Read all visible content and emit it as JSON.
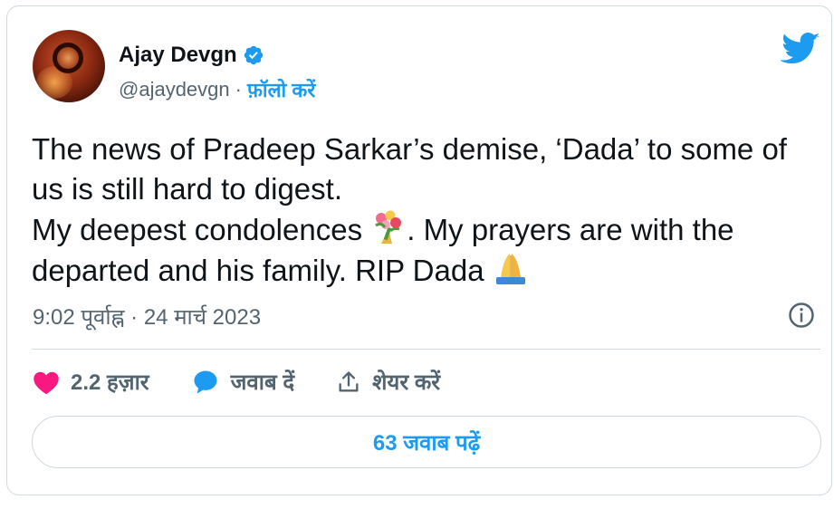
{
  "author": {
    "name": "Ajay Devgn",
    "handle": "@ajaydevgn",
    "separator": "·",
    "follow_label": "फ़ॉलो करें"
  },
  "tweet": {
    "line1": "The news of Pradeep Sarkar’s demise, ‘Dada’ to some of",
    "line2": "us is still hard to digest.",
    "line3a": "My deepest condolences ",
    "line3b": ". My prayers are with the",
    "line4a": "departed and his family. RIP Dada "
  },
  "meta": {
    "timestamp": "9:02 पूर्वाह्न · 24 मार्च 2023"
  },
  "actions": {
    "likes": "2.2 हज़ार",
    "reply": "जवाब दें",
    "share": "शेयर करें"
  },
  "replies_button": "63 जवाब पढ़ें",
  "colors": {
    "accent": "#1d9bf0",
    "like": "#f91880",
    "muted": "#536471",
    "text": "#0f1419",
    "border": "#cfd9de"
  },
  "icons": [
    "verified-badge-icon",
    "twitter-bird-icon",
    "bouquet-emoji",
    "folded-hands-emoji",
    "info-icon",
    "heart-icon",
    "reply-bubble-icon",
    "share-icon"
  ]
}
